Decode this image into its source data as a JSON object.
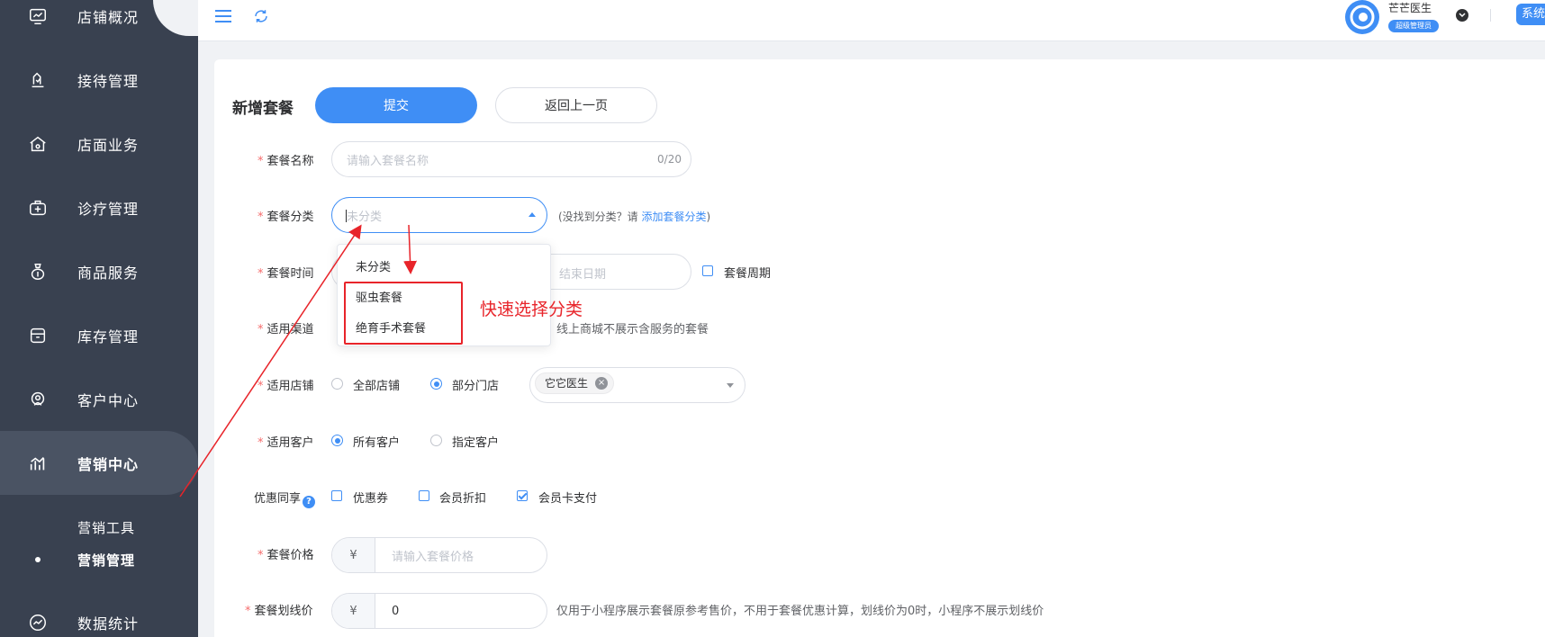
{
  "sidebar": {
    "items": [
      {
        "label": "店铺概况",
        "icon": "dashboard-icon"
      },
      {
        "label": "接待管理",
        "icon": "clipboard-icon"
      },
      {
        "label": "店面业务",
        "icon": "store-icon"
      },
      {
        "label": "诊疗管理",
        "icon": "medical-kit-icon"
      },
      {
        "label": "商品服务",
        "icon": "bag-icon"
      },
      {
        "label": "库存管理",
        "icon": "archive-icon"
      },
      {
        "label": "客户中心",
        "icon": "customer-icon"
      },
      {
        "label": "营销中心",
        "icon": "chart-icon"
      },
      {
        "label": "数据统计",
        "icon": "trend-icon"
      }
    ],
    "sub_items": [
      {
        "label": "营销工具"
      },
      {
        "label": "营销管理"
      }
    ]
  },
  "header": {
    "user_name": "芒芒医生",
    "role": "超级管理员",
    "system_button": "系统"
  },
  "page": {
    "title": "新增套餐",
    "submit_label": "提交",
    "back_label": "返回上一页"
  },
  "form": {
    "name": {
      "label": "套餐名称",
      "placeholder": "请输入套餐名称",
      "counter": "0/20"
    },
    "category": {
      "label": "套餐分类",
      "placeholder": "未分类",
      "hint_prefix": "(没找到分类？请 ",
      "hint_link": "添加套餐分类",
      "hint_suffix": ")",
      "options": [
        "未分类",
        "驱虫套餐",
        "绝育手术套餐"
      ]
    },
    "time": {
      "label": "套餐时间",
      "end_placeholder": "结束日期",
      "period_label": "套餐周期"
    },
    "channel": {
      "label": "适用渠道",
      "hint": "线上商城不展示含服务的套餐"
    },
    "store": {
      "label": "适用店铺",
      "option_all": "全部店铺",
      "option_partial": "部分门店",
      "selected_tag": "它它医生"
    },
    "customer": {
      "label": "适用客户",
      "option_all": "所有客户",
      "option_specific": "指定客户"
    },
    "discount": {
      "label": "优惠同享",
      "coupon": "优惠券",
      "member_discount": "会员折扣",
      "member_card": "会员卡支付"
    },
    "price": {
      "label": "套餐价格",
      "prefix": "¥",
      "placeholder": "请输入套餐价格"
    },
    "original_price": {
      "label": "套餐划线价",
      "prefix": "¥",
      "value": "0",
      "hint": "仅用于小程序展示套餐原参考售价，不用于套餐优惠计算，划线价为0时，小程序不展示划线价"
    }
  },
  "annotation": {
    "text": "快速选择分类",
    "color": "#e8242a"
  },
  "colors": {
    "primary": "#3f8ef5",
    "sidebar": "#394150",
    "danger": "#f56c6c"
  }
}
